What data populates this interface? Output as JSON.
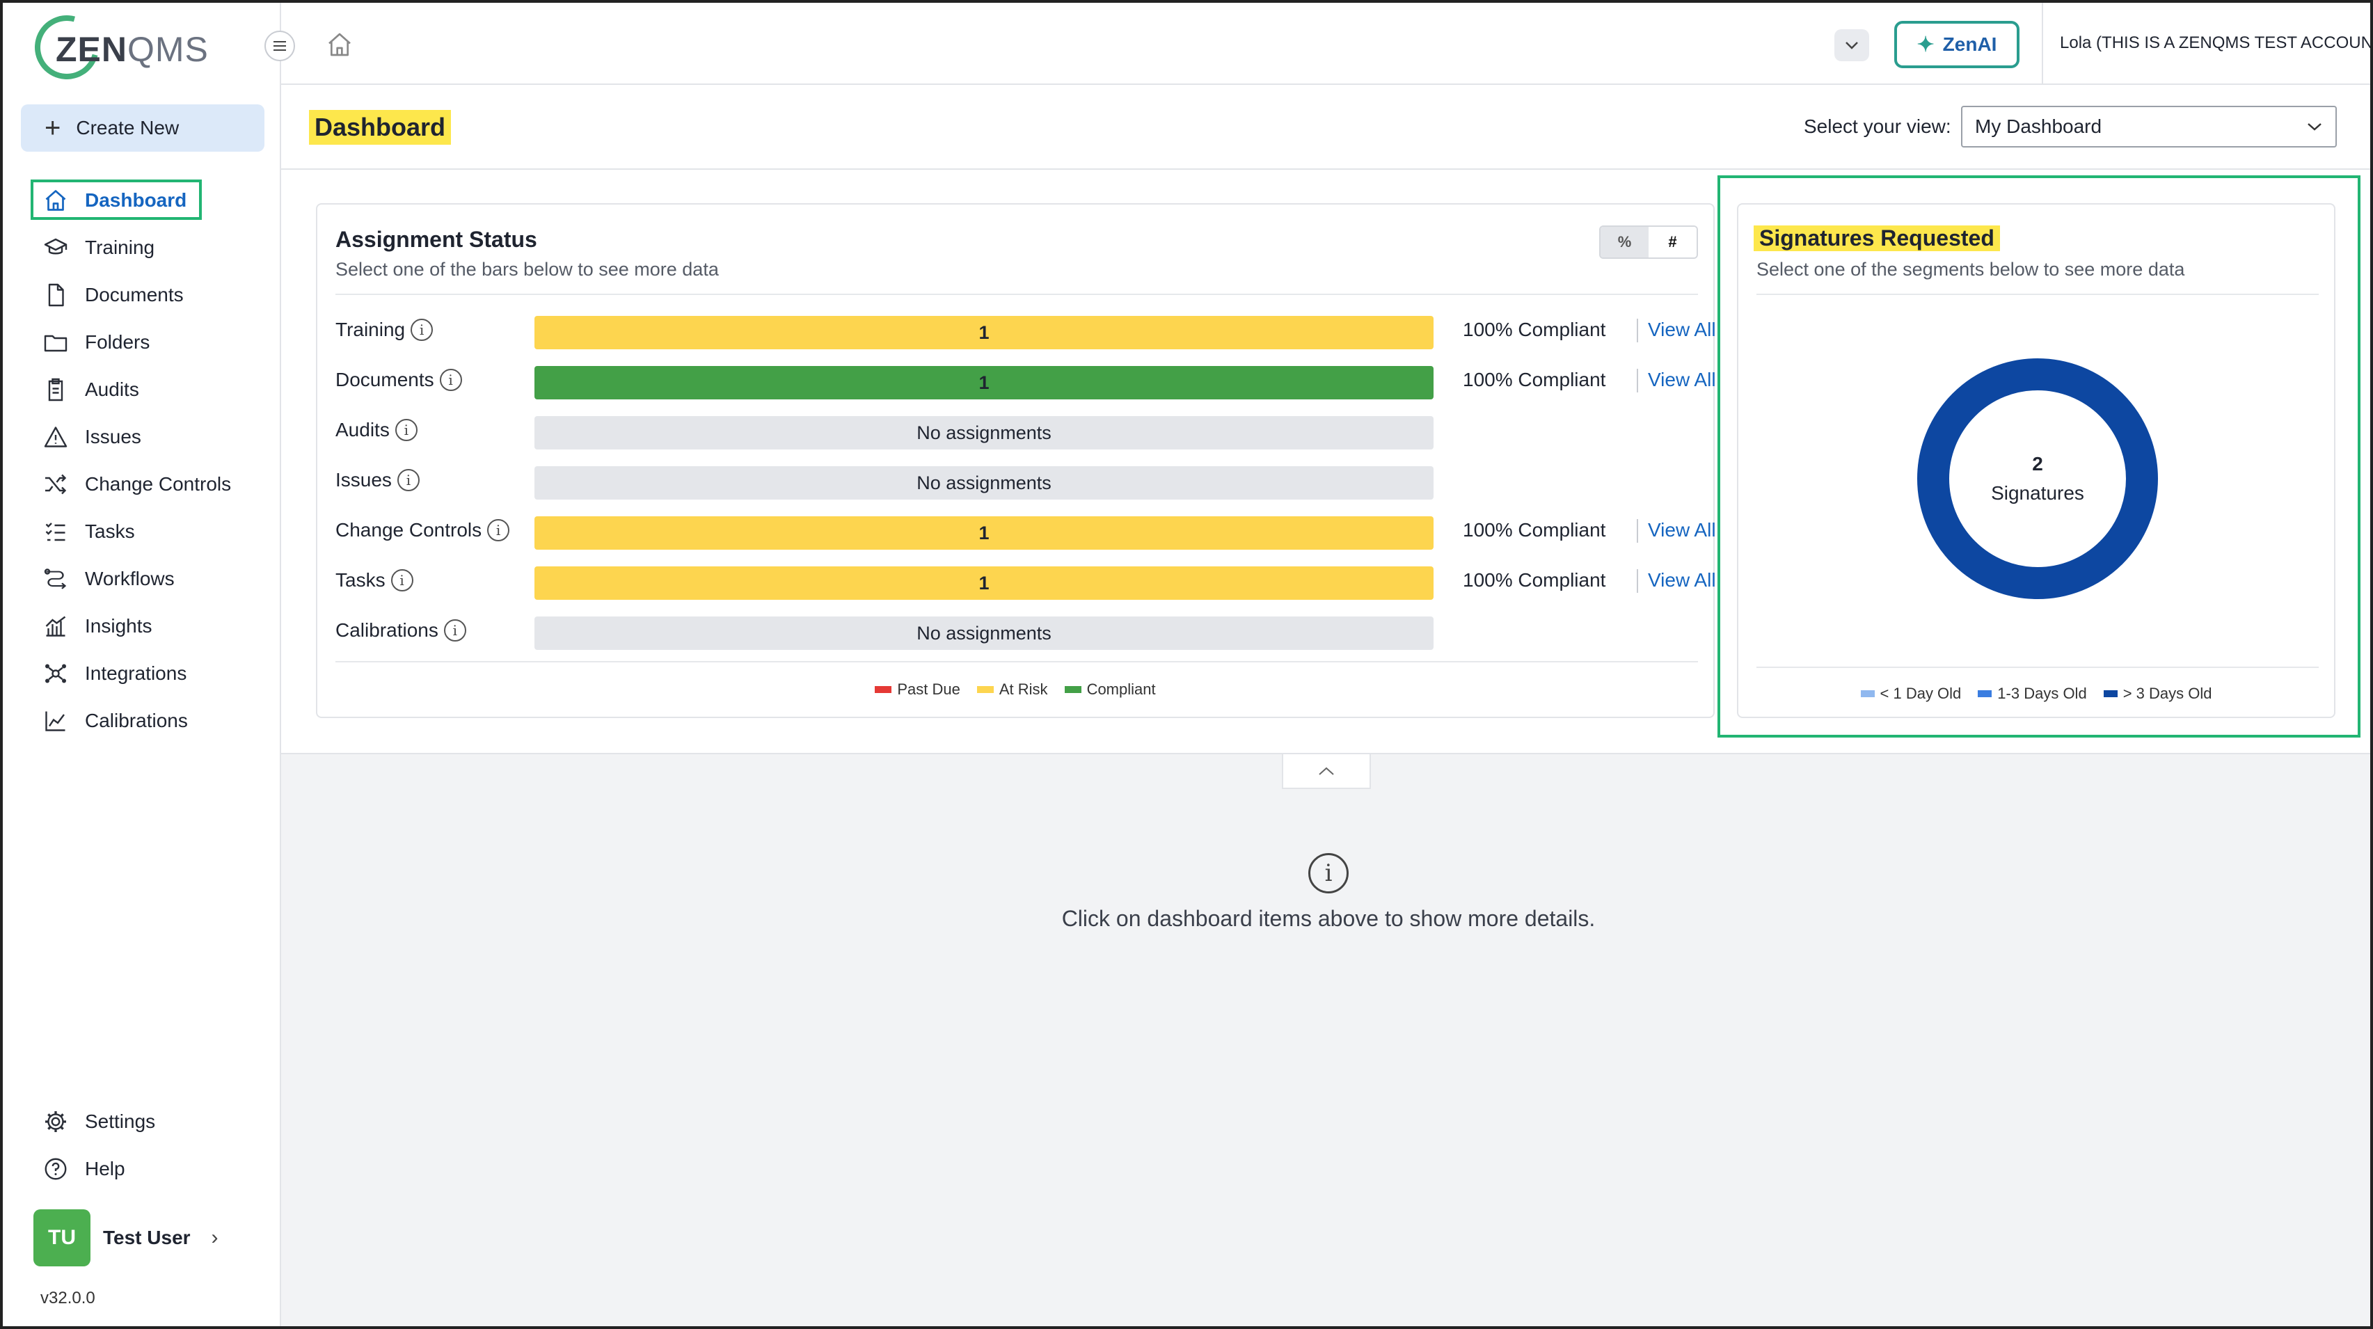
{
  "brand": {
    "logo_bold": "ZEN",
    "logo_light": "QMS",
    "accent": "#22b573",
    "primary": "#1565c0"
  },
  "sidebar": {
    "create_new": "Create New",
    "items": [
      {
        "label": "Dashboard",
        "icon": "home-icon",
        "active": true
      },
      {
        "label": "Training",
        "icon": "graduation-cap-icon"
      },
      {
        "label": "Documents",
        "icon": "document-icon"
      },
      {
        "label": "Folders",
        "icon": "folder-icon"
      },
      {
        "label": "Audits",
        "icon": "clipboard-icon"
      },
      {
        "label": "Issues",
        "icon": "warning-icon"
      },
      {
        "label": "Change Controls",
        "icon": "shuffle-icon"
      },
      {
        "label": "Tasks",
        "icon": "checklist-icon"
      },
      {
        "label": "Workflows",
        "icon": "workflow-icon"
      },
      {
        "label": "Insights",
        "icon": "bar-chart-icon"
      },
      {
        "label": "Integrations",
        "icon": "network-icon"
      },
      {
        "label": "Calibrations",
        "icon": "line-chart-icon"
      }
    ],
    "bottom_items": [
      {
        "label": "Settings",
        "icon": "gear-icon"
      },
      {
        "label": "Help",
        "icon": "help-circle-icon"
      }
    ],
    "user": {
      "initials": "TU",
      "name": "Test User"
    },
    "version": "v32.0.0"
  },
  "topbar": {
    "zenai_label": "ZenAI",
    "account": "Lola (THIS IS A ZENQMS TEST ACCOUNT)"
  },
  "header": {
    "title": "Dashboard",
    "view_label": "Select your view:",
    "view_value": "My Dashboard"
  },
  "assignment_status": {
    "title": "Assignment Status",
    "subtitle": "Select one of the bars below to see more data",
    "toggle": {
      "pct": "%",
      "num": "#"
    },
    "rows": [
      {
        "label": "Training",
        "bar_text": "1",
        "status": "at-risk",
        "compliance": "100% Compliant",
        "link": "View All"
      },
      {
        "label": "Documents",
        "bar_text": "1",
        "status": "compliant",
        "compliance": "100% Compliant",
        "link": "View All"
      },
      {
        "label": "Audits",
        "bar_text": "No assignments",
        "status": "none",
        "compliance": "",
        "link": ""
      },
      {
        "label": "Issues",
        "bar_text": "No assignments",
        "status": "none",
        "compliance": "",
        "link": ""
      },
      {
        "label": "Change Controls",
        "bar_text": "1",
        "status": "at-risk",
        "compliance": "100% Compliant",
        "link": "View All"
      },
      {
        "label": "Tasks",
        "bar_text": "1",
        "status": "at-risk",
        "compliance": "100% Compliant",
        "link": "View All"
      },
      {
        "label": "Calibrations",
        "bar_text": "No assignments",
        "status": "none",
        "compliance": "",
        "link": ""
      }
    ],
    "legend": [
      {
        "label": "Past Due",
        "color": "#e53935"
      },
      {
        "label": "At Risk",
        "color": "#fdd54f"
      },
      {
        "label": "Compliant",
        "color": "#43a047"
      }
    ],
    "status_colors": {
      "at-risk": "#fdd54f",
      "compliant": "#43a047",
      "none": "#e4e6ea"
    }
  },
  "signatures": {
    "title": "Signatures Requested",
    "subtitle": "Select one of the segments below to see more data",
    "total": "2",
    "caption": "Signatures",
    "segments": [
      {
        "label": "< 1 Day Old",
        "value": 0,
        "color": "#90b8ef"
      },
      {
        "label": "1-3 Days Old",
        "value": 0,
        "color": "#3a7de0"
      },
      {
        "label": "> 3 Days Old",
        "value": 2,
        "color": "#0d47a1"
      }
    ]
  },
  "details": {
    "message": "Click on dashboard items above to show more details."
  }
}
